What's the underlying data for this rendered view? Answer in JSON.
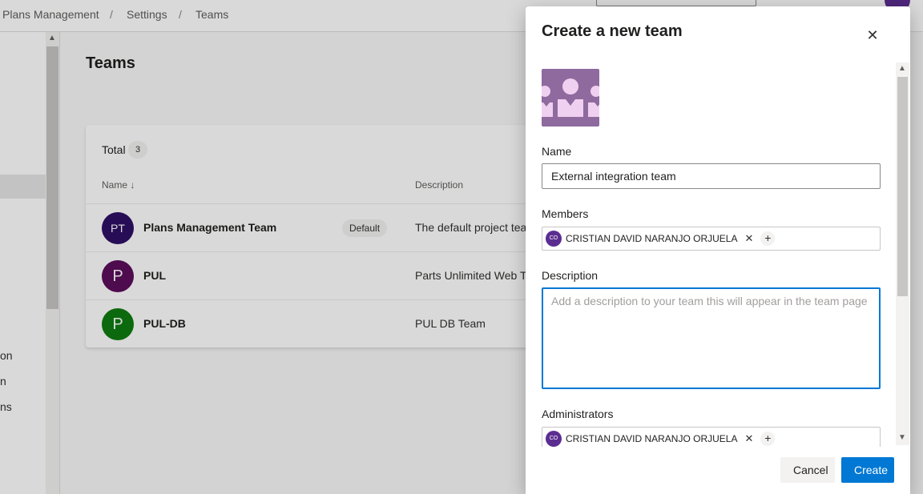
{
  "breadcrumb": [
    "Plans Management",
    "Settings",
    "Teams"
  ],
  "leftnav": {
    "items": [
      "on",
      "n",
      "ns"
    ]
  },
  "page": {
    "title": "Teams"
  },
  "teams_table": {
    "total_label": "Total",
    "total_count": "3",
    "columns": {
      "name": "Name",
      "name_sort_icon": "↓",
      "description": "Description"
    },
    "rows": [
      {
        "initials": "PT",
        "name": "Plans Management Team",
        "tag": "Default",
        "description": "The default project tea",
        "color": "#2e1065"
      },
      {
        "initials": "P",
        "name": "PUL",
        "tag": "",
        "description": "Parts Unlimited Web Te",
        "color": "#5c0e5c"
      },
      {
        "initials": "P",
        "name": "PUL-DB",
        "tag": "",
        "description": "PUL DB Team",
        "color": "#107c10"
      }
    ]
  },
  "dialog": {
    "title": "Create a new team",
    "close_icon": "close-icon",
    "name_label": "Name",
    "name_value": "External integration team",
    "members_label": "Members",
    "member": {
      "initials": "CO",
      "name": "CRISTIAN DAVID NARANJO ORJUELA"
    },
    "description_label": "Description",
    "description_placeholder": "Add a description to your team this will appear in the team page",
    "administrators_label": "Administrators",
    "admin": {
      "initials": "CO",
      "name": "CRISTIAN DAVID NARANJO ORJUELA"
    },
    "cancel_label": "Cancel",
    "create_label": "Create",
    "accent_color": "#0078d4"
  }
}
